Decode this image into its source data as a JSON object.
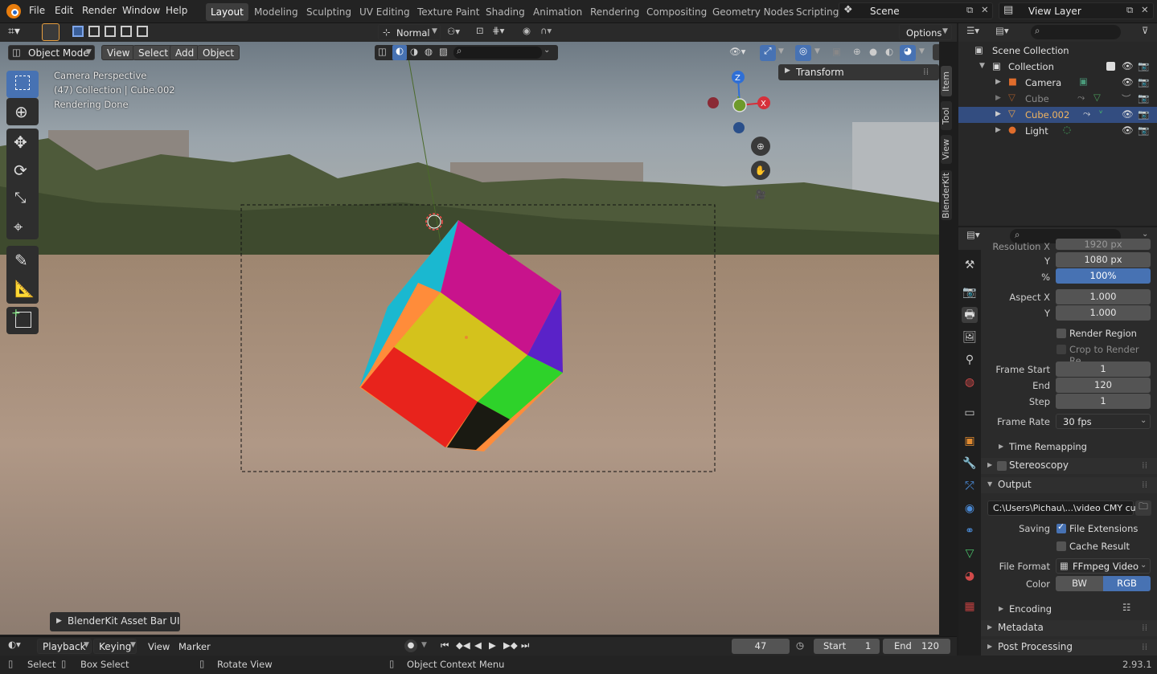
{
  "app": {
    "version": "2.93.1"
  },
  "menubar": {
    "items": [
      "File",
      "Edit",
      "Render",
      "Window",
      "Help"
    ]
  },
  "workspaces": {
    "tabs": [
      "Layout",
      "Modeling",
      "Sculpting",
      "UV Editing",
      "Texture Paint",
      "Shading",
      "Animation",
      "Rendering",
      "Compositing",
      "Geometry Nodes",
      "Scripting"
    ],
    "active": "Layout"
  },
  "scene": {
    "name": "Scene",
    "view_layer": "View Layer"
  },
  "viewport_header": {
    "orientation": "Normal",
    "options_label": "Options",
    "mode": "Object Mode",
    "menus": [
      "View",
      "Select",
      "Add",
      "Object"
    ]
  },
  "viewport": {
    "overlay_lines": [
      "Camera Perspective",
      "(47) Collection | Cube.002",
      "Rendering Done"
    ],
    "transform_panel": "Transform",
    "side_tabs": [
      "Item",
      "Tool",
      "View",
      "BlenderKit"
    ],
    "gizmo_axes": {
      "z": "Z",
      "x": "X"
    },
    "asset_bar": "BlenderKit Asset Bar UI",
    "colors": {
      "selection_outline": "#ff8c3a",
      "cube_red": "#e8231c",
      "cube_yellow": "#d4c21c",
      "cube_green": "#2ed22a",
      "cube_magenta": "#c8138c",
      "cube_cyan": "#1ab8d0"
    }
  },
  "outliner": {
    "root": "Scene Collection",
    "collection": "Collection",
    "items": [
      {
        "name": "Camera",
        "icon": "camera-icon",
        "selected": false,
        "color": "#e06d2c"
      },
      {
        "name": "Cube",
        "icon": "mesh-icon",
        "selected": false,
        "color": "#e06d2c",
        "dimmed": true
      },
      {
        "name": "Cube.002",
        "icon": "mesh-icon",
        "selected": true,
        "color": "#e8a14a"
      },
      {
        "name": "Light",
        "icon": "light-icon",
        "selected": false,
        "color": "#e06d2c"
      }
    ]
  },
  "properties": {
    "resolution_x_label": "Resolution X",
    "resolution_x": "1920 px",
    "resolution_y_label": "Y",
    "resolution_y": "1080 px",
    "percent_label": "%",
    "percent": "100%",
    "aspect_x_label": "Aspect X",
    "aspect_x": "1.000",
    "aspect_y_label": "Y",
    "aspect_y": "1.000",
    "render_region": "Render Region",
    "crop": "Crop to Render Re...",
    "frame_start_label": "Frame Start",
    "frame_start": "1",
    "end_label": "End",
    "frame_end": "120",
    "step_label": "Step",
    "step": "1",
    "frame_rate_label": "Frame Rate",
    "frame_rate": "30 fps",
    "time_remapping": "Time Remapping",
    "stereoscopy": "Stereoscopy",
    "output": "Output",
    "output_path": "C:\\Users\\Pichau\\...\\video CMY cube",
    "saving_label": "Saving",
    "file_extensions": "File Extensions",
    "cache_result": "Cache Result",
    "file_format_label": "File Format",
    "file_format": "FFmpeg Video",
    "color_label": "Color",
    "color_bw": "BW",
    "color_rgb": "RGB",
    "encoding": "Encoding",
    "metadata": "Metadata",
    "post_processing": "Post Processing"
  },
  "timeline": {
    "menus": [
      "Playback",
      "Keying",
      "View",
      "Marker"
    ],
    "current_frame": "47",
    "start_label": "Start",
    "start": "1",
    "end_label": "End",
    "end": "120"
  },
  "statusbar": {
    "select": "Select",
    "box_select": "Box Select",
    "rotate_view": "Rotate View",
    "context_menu": "Object Context Menu"
  }
}
